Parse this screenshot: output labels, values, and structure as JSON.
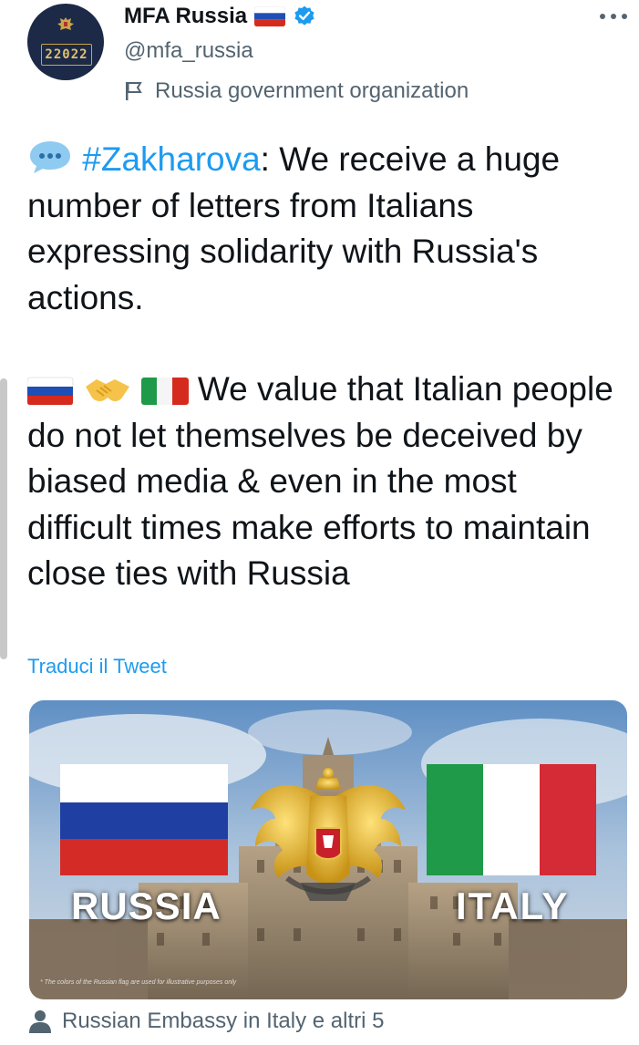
{
  "account": {
    "name": "MFA Russia",
    "handle": "@mfa_russia",
    "label": "Russia government organization",
    "avatar_year": "22022"
  },
  "tweet": {
    "hashtag": "#Zakharova",
    "text_1": ": We receive a huge number of letters from Italians expressing solidarity with Russia's actions.",
    "text_2": " We value that Italian people do not let themselves be deceived by biased media & even in the most difficult times make efforts to maintain close ties with Russia",
    "translate_link": "Traduci il Tweet"
  },
  "media": {
    "label_left": "RUSSIA",
    "label_right": "ITALY",
    "disclaimer": "* The colors of the Russian flag are used for illustrative purposes only"
  },
  "tagged_users": "Russian Embassy in Italy e altri 5",
  "colors": {
    "link": "#1d9bf0",
    "secondary_text": "#536471",
    "verified": "#1d9bf0"
  },
  "icons": [
    "emblem-icon",
    "russia-flag-icon",
    "verified-icon",
    "more-icon",
    "flag-icon",
    "speech-bubble-icon",
    "handshake-icon",
    "italy-flag-icon",
    "person-icon"
  ]
}
